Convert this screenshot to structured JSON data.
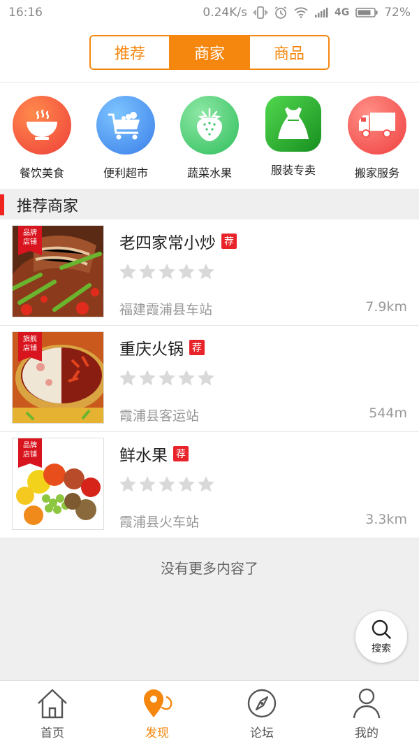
{
  "status_bar": {
    "time": "16:16",
    "net_speed": "0.24K/s",
    "network": "4G",
    "battery": "72%"
  },
  "header": {
    "tabs": [
      {
        "label": "推荐",
        "active": false
      },
      {
        "label": "商家",
        "active": true
      },
      {
        "label": "商品",
        "active": false
      }
    ]
  },
  "categories": [
    {
      "label": "餐饮美食",
      "icon": "bowl-icon",
      "color": "#f25a3d"
    },
    {
      "label": "便利超市",
      "icon": "cart-icon",
      "color": "#3d8ff0"
    },
    {
      "label": "蔬菜水果",
      "icon": "strawberry-icon",
      "color": "#3cc46b"
    },
    {
      "label": "服装专卖",
      "icon": "dress-icon",
      "color": "#2fb12f"
    },
    {
      "label": "搬家服务",
      "icon": "truck-icon",
      "color": "#f4534f"
    }
  ],
  "section": {
    "title": "推荐商家"
  },
  "merchants": [
    {
      "badge": [
        "品牌",
        "店铺"
      ],
      "name": "老四家常小炒",
      "tag": "荐",
      "rating": 0,
      "address": "福建霞浦县车站",
      "distance": "7.9km"
    },
    {
      "badge": [
        "旗舰",
        "店铺"
      ],
      "name": "重庆火锅",
      "tag": "荐",
      "rating": 0,
      "address": "霞浦县客运站",
      "distance": "544m"
    },
    {
      "badge": [
        "品牌",
        "店铺"
      ],
      "name": "鲜水果",
      "tag": "荐",
      "rating": 0,
      "address": "霞浦县火车站",
      "distance": "3.3km"
    }
  ],
  "footer_note": "没有更多内容了",
  "search_fab": {
    "label": "搜索",
    "icon": "search-icon"
  },
  "bottom_nav": [
    {
      "label": "首页",
      "icon": "home-icon",
      "active": false
    },
    {
      "label": "发现",
      "icon": "location-icon",
      "active": true
    },
    {
      "label": "论坛",
      "icon": "compass-icon",
      "active": false
    },
    {
      "label": "我的",
      "icon": "user-icon",
      "active": false
    }
  ],
  "colors": {
    "accent": "#f5870f",
    "badge_red": "#d8141f",
    "tag_red": "#e8242a",
    "star_empty": "#d9d9d9"
  }
}
